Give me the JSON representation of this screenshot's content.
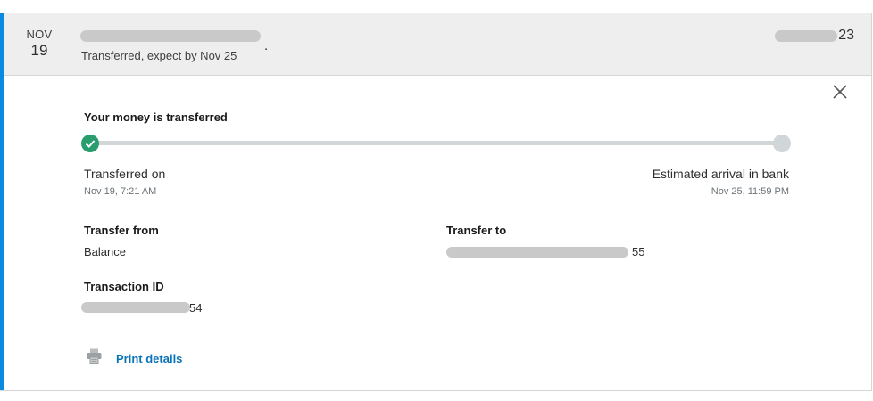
{
  "transaction": {
    "month": "NOV",
    "day": "19",
    "subtitle": "Transferred, expect by Nov 25",
    "title_tail": ".",
    "amount_tail": "23"
  },
  "details": {
    "status_title": "Your money is transferred",
    "transferred_label": "Transferred on",
    "transferred_time": "Nov 19, 7:21 AM",
    "arrival_label": "Estimated arrival in bank",
    "arrival_time": "Nov 25, 11:59 PM",
    "from_label": "Transfer from",
    "from_value": "Balance",
    "to_label": "Transfer to",
    "to_value_tail": "55",
    "txn_label": "Transaction ID",
    "txn_value_tail": "54",
    "print_label": "Print details"
  },
  "progress": {
    "completed_steps": 1,
    "total_steps": 2
  },
  "colors": {
    "accent": "#0b8be0",
    "success": "#2a9d6f",
    "link": "#0a73b8",
    "header_bg": "#eeeeee"
  },
  "icons": {
    "close": "close-icon",
    "check": "check-icon",
    "print": "printer-icon"
  }
}
